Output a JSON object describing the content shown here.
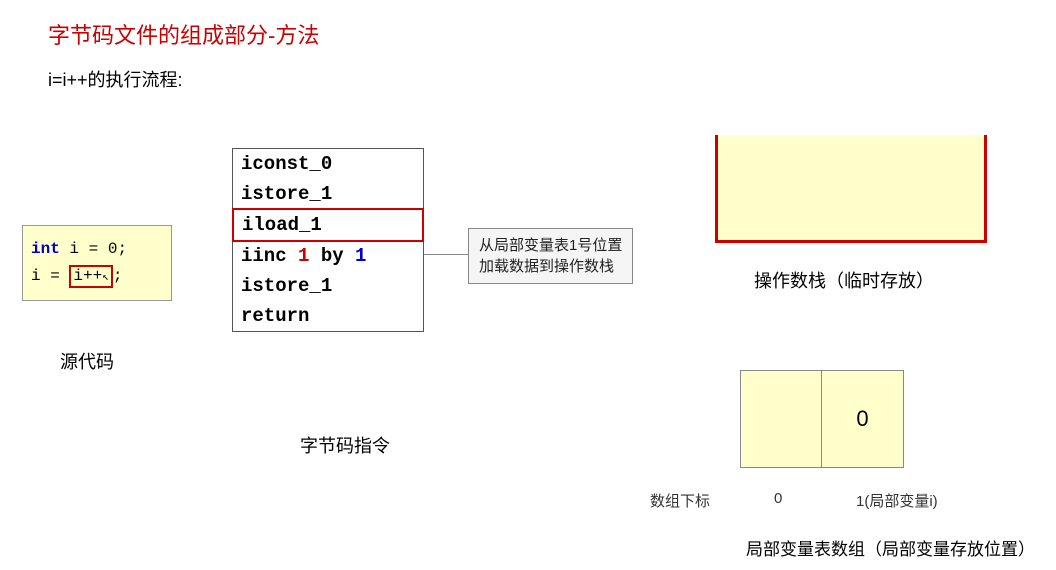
{
  "title": "字节码文件的组成部分-方法",
  "subtitle": "i=i++的执行流程:",
  "source": {
    "line1_kw": "int",
    "line1_rest": " i = ",
    "line1_val": "0",
    "line1_end": ";",
    "line2_pre": "i = ",
    "line2_hl": "i++",
    "line2_end": ";",
    "label": "源代码"
  },
  "bytecode": {
    "lines": [
      {
        "text": "iconst_0",
        "highlight": false
      },
      {
        "text": "istore_1",
        "highlight": false
      },
      {
        "text": "iload_1",
        "highlight": true
      },
      {
        "prefix": "iinc ",
        "arg1": "1",
        "mid": " by ",
        "arg2": "1",
        "highlight": false,
        "colored": true
      },
      {
        "text": "istore_1",
        "highlight": false
      },
      {
        "text": "return",
        "highlight": false
      }
    ],
    "label": "字节码指令"
  },
  "annotation": {
    "line1": "从局部变量表1号位置",
    "line2": "加载数据到操作数栈"
  },
  "operand_stack": {
    "label": "操作数栈（临时存放）"
  },
  "local_var_table": {
    "cells": [
      "",
      "0"
    ],
    "index_label": "数组下标",
    "idx0": "0",
    "idx1": "1(局部变量i)",
    "label": "局部变量表数组（局部变量存放位置）"
  }
}
